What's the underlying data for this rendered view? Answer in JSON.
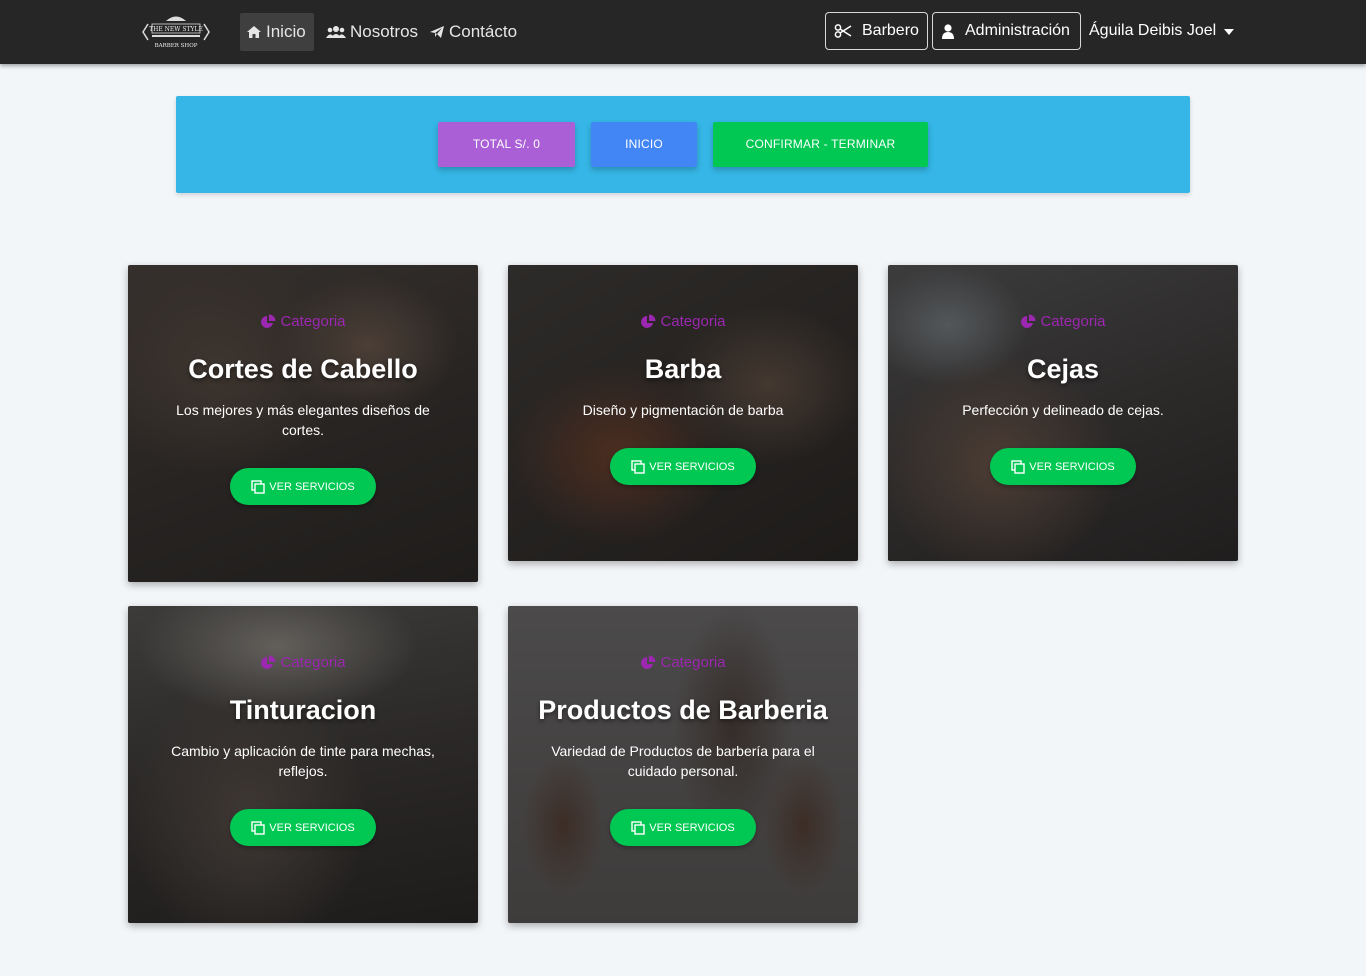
{
  "navbar": {
    "logo_alt": "The New Style Barber Shop",
    "logo_line1": "THE NEW STYLE",
    "logo_line2": "BARBER SHOP",
    "links": [
      {
        "label": "Inicio",
        "icon": "home-icon"
      },
      {
        "label": "Nosotros",
        "icon": "users-icon"
      },
      {
        "label": "Contácto",
        "icon": "paper-plane-icon"
      }
    ],
    "barbero_label": "Barbero",
    "admin_label": "Administración",
    "user_name": "Águila Deibis Joel"
  },
  "actions": {
    "total_label": "TOTAL S/. 0",
    "inicio_label": "INICIO",
    "confirm_label": "CONFIRMAR - TERMINAR",
    "colors": {
      "total": "#ab5fd6",
      "inicio": "#4285f4",
      "confirm": "#00c853",
      "panel": "#35b6e6"
    }
  },
  "cards": [
    {
      "category": "Categoria",
      "title": "Cortes de Cabello",
      "description": "Los mejores y más elegantes diseños de cortes.",
      "button": "VER SERVICIOS"
    },
    {
      "category": "Categoria",
      "title": "Barba",
      "description": "Diseño y pigmentación de barba",
      "button": "VER SERVICIOS"
    },
    {
      "category": "Categoria",
      "title": "Cejas",
      "description": "Perfección y delineado de cejas.",
      "button": "VER SERVICIOS"
    },
    {
      "category": "Categoria",
      "title": "Tinturacion",
      "description": "Cambio y aplicación de tinte para mechas, reflejos.",
      "button": "VER SERVICIOS"
    },
    {
      "category": "Categoria",
      "title": "Productos de Barberia",
      "description": "Variedad de Productos de barbería para el cuidado personal.",
      "button": "VER SERVICIOS"
    }
  ]
}
